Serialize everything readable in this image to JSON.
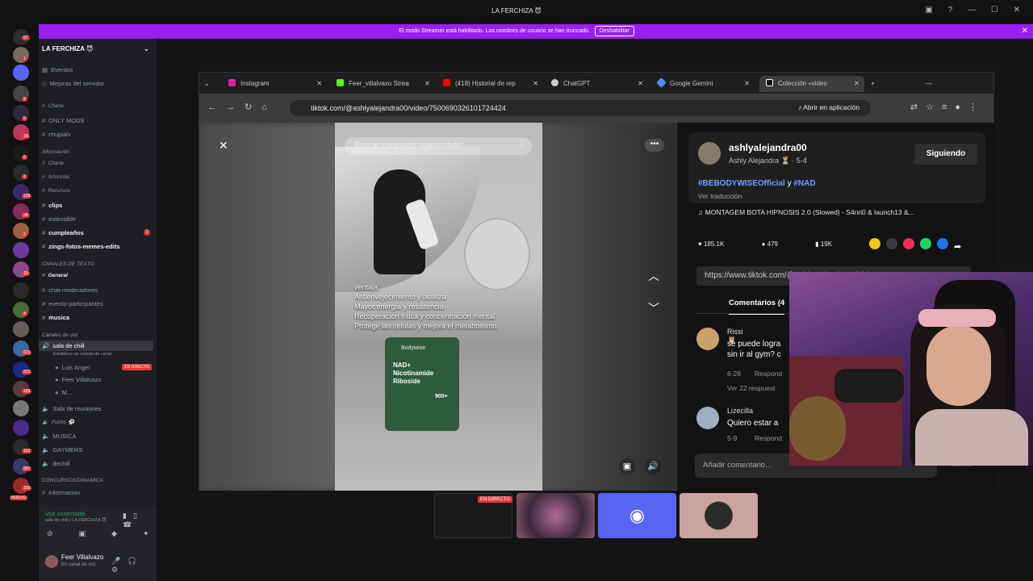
{
  "window": {
    "title": "LA FERCHIZA 😈"
  },
  "streamer_banner": {
    "text": "El modo Streamer está habilitado. Los nombres de usuario se han truncado.",
    "button": "Deshabilitar"
  },
  "server_badges": [
    "97",
    "1",
    "2",
    "5",
    "18",
    "2",
    "1",
    "129",
    "38",
    "2",
    "10",
    "4",
    "621",
    "213",
    "169",
    "110",
    "367",
    "150",
    "NUEVO"
  ],
  "server": {
    "name": "LA FERCHIZA 😈",
    "channels": [
      {
        "name": "Eventos"
      },
      {
        "name": "Mejoras del servidor"
      },
      {
        "name": "Charla"
      },
      {
        "name": "ONLY MODS"
      },
      {
        "name": "chupialv"
      },
      {
        "name": "Información"
      },
      {
        "name": "Charla"
      },
      {
        "name": "Anuncios"
      },
      {
        "name": "Recursos"
      },
      {
        "name": "clips"
      },
      {
        "name": "extensible"
      },
      {
        "name": "cumpleaños",
        "badge": "1"
      },
      {
        "name": "zings-fotos-memes-edits"
      },
      {
        "name": "CANALES DE TEXTO"
      },
      {
        "name": "General"
      },
      {
        "name": "chat-moderadores"
      },
      {
        "name": "evento-participantes"
      },
      {
        "name": "musica"
      },
      {
        "name": "Canales de voz"
      },
      {
        "name": "sala de chill"
      },
      {
        "name": "Establece un estado de canal"
      },
      {
        "name": "Luis Angel"
      },
      {
        "name": "Feer Villalvazo"
      },
      {
        "name": "M..."
      },
      {
        "name": "Sala de reuniones"
      },
      {
        "name": "Fucho ⚽"
      },
      {
        "name": "MUSICA"
      },
      {
        "name": "GAYMERS"
      },
      {
        "name": "dechill"
      },
      {
        "name": "CONCURSOS/DINAMICA"
      },
      {
        "name": "informacion"
      }
    ],
    "live_label": "EN DIRECTO"
  },
  "voice": {
    "status": "Voz conectada",
    "location": "sala de chill / LA FERCHIZA 😈"
  },
  "user": {
    "name": "Feer Villalvazo",
    "status": "En canal de voz"
  },
  "browser": {
    "tabs": [
      {
        "label": "Instagram",
        "color": "#d6249f"
      },
      {
        "label": "Feer_villalvaxo Strea",
        "color": "#53fc18"
      },
      {
        "label": "(418) Historial de rep",
        "color": "#ff0000"
      },
      {
        "label": "ChatGPT",
        "color": "#cccccc"
      },
      {
        "label": "Google Gemini",
        "color": "#4a8cff"
      },
      {
        "label": "Colección «video",
        "color": "#ffffff"
      }
    ],
    "url": "tiktok.com/@ashlyalejandra00/video/7500690326101724424",
    "open_in_app": "Abrir en aplicación"
  },
  "video": {
    "search_placeholder": "Buscar contenido relacionado",
    "overlay_text": [
      "ventaja:",
      "Antienvejecimiento y belleza",
      "Mayor energía y resistencia",
      "Recuperación física y concentración mental",
      "Protege las células y mejora el metabolismo."
    ],
    "product": {
      "brand": "Bodywise",
      "name": "Nicotinamide Riboside",
      "sub": "NAD+",
      "grams": "900+"
    }
  },
  "post": {
    "username": "ashlyalejandra00",
    "nickname": "Ashly Alejandra ⏳ · 5-4",
    "follow_button": "Siguiendo",
    "hashtags": [
      "#BEBODYWISEOfficial",
      "y",
      "#NAD"
    ],
    "translate": "Ver traducción",
    "music": "♫  MONTAGEM BOTA HIPNOSIS 2.0 (Slowed) - S4nri0 & launch13 &...",
    "likes": "185.1K",
    "comments_count": "479",
    "saves": "19K",
    "link": "https://www.tiktok.com/@ashlyalejandra00/vide...",
    "comments_tab": "Comentarios (4",
    "comments": [
      {
        "author": "Rissi 🦉",
        "text": [
          "se puede logra",
          "sin ir al gym? c"
        ],
        "date": "6-26",
        "reply": "Respond",
        "more": "Ver 22 respuest"
      },
      {
        "author": "Lizecilla",
        "text": [
          "Quiero estar a"
        ],
        "date": "5-9",
        "reply": "Respond"
      }
    ],
    "add_comment": "Añadir comentario...",
    "publish": "Publicar"
  },
  "share_colors": [
    "#f5c518",
    "#3a3a3a",
    "#fe2c55",
    "#25d366",
    "#1877f2"
  ],
  "thumb_live": "EN DIRECTO",
  "discord_color": "#5865f2"
}
